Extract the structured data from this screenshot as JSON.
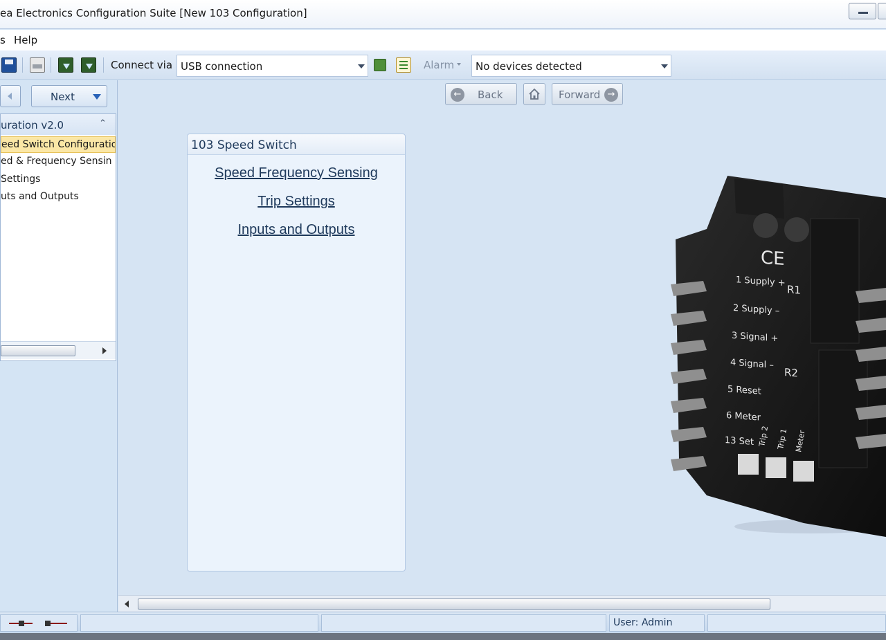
{
  "window": {
    "title": "ea Electronics Configuration Suite [New 103 Configuration]"
  },
  "menu": {
    "items": [
      "s",
      "Help"
    ]
  },
  "toolbar": {
    "connect_label": "Connect via",
    "connection_value": "USB connection",
    "alarm_label": "Alarm",
    "device_value": "No devices detected"
  },
  "left_nav": {
    "next_label": "Next",
    "tree_title": "uration v2.0",
    "items": [
      "eed Switch Configuratio",
      "ed & Frequency Sensin",
      " Settings",
      "uts and Outputs"
    ],
    "selected_index": 0
  },
  "browser_nav": {
    "back_label": "Back",
    "forward_label": "Forward"
  },
  "panel": {
    "title": "103 Speed Switch",
    "links": [
      "Speed  Frequency Sensing",
      "Trip Settings",
      "Inputs and Outputs"
    ]
  },
  "device": {
    "ce_mark": "CE",
    "terminals": [
      "1 Supply +",
      "2 Supply –",
      "3 Signal +",
      "4 Signal –",
      "5 Reset",
      "6 Meter",
      "13 Set"
    ],
    "relays": [
      "R1",
      "R2"
    ],
    "side_labels": [
      "Trip 2",
      "Trip 1",
      "Meter"
    ]
  },
  "status": {
    "user": "User: Admin"
  },
  "colors": {
    "accent": "#1e395b",
    "selection": "#fbe7a6",
    "background": "#d4e4f4"
  }
}
